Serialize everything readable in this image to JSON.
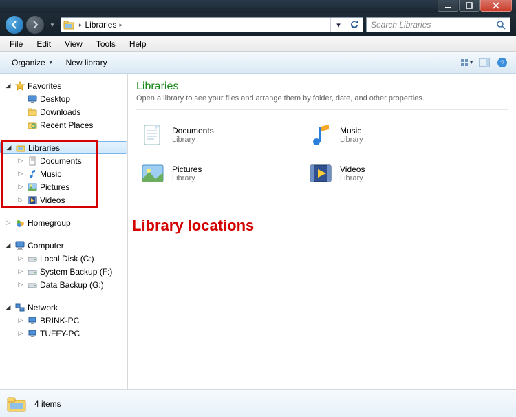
{
  "breadcrumb": {
    "root_label": "Libraries"
  },
  "search": {
    "placeholder": "Search Libraries"
  },
  "menubar": [
    "File",
    "Edit",
    "View",
    "Tools",
    "Help"
  ],
  "toolbar": {
    "organize": "Organize",
    "new_library": "New library"
  },
  "sidebar": {
    "favorites": {
      "label": "Favorites",
      "items": [
        "Desktop",
        "Downloads",
        "Recent Places"
      ]
    },
    "libraries": {
      "label": "Libraries",
      "items": [
        "Documents",
        "Music",
        "Pictures",
        "Videos"
      ]
    },
    "homegroup": {
      "label": "Homegroup"
    },
    "computer": {
      "label": "Computer",
      "items": [
        "Local Disk (C:)",
        "System Backup (F:)",
        "Data Backup (G:)"
      ]
    },
    "network": {
      "label": "Network",
      "items": [
        "BRINK-PC",
        "TUFFY-PC"
      ]
    }
  },
  "main": {
    "heading": "Libraries",
    "subheading": "Open a library to see your files and arrange them by folder, date, and other properties.",
    "items": [
      {
        "name": "Documents",
        "type": "Library"
      },
      {
        "name": "Music",
        "type": "Library"
      },
      {
        "name": "Pictures",
        "type": "Library"
      },
      {
        "name": "Videos",
        "type": "Library"
      }
    ]
  },
  "annotation": "Library locations",
  "status": {
    "count_text": "4 items"
  }
}
